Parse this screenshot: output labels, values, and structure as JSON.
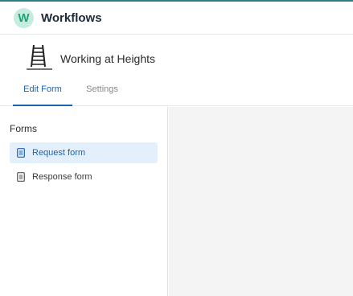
{
  "app": {
    "logo_letter": "W",
    "title": "Workflows"
  },
  "header": {
    "thumbnail_icon": "ladder-icon",
    "workflow_name": "Working at Heights"
  },
  "tabs": [
    {
      "label": "Edit Form",
      "active": true
    },
    {
      "label": "Settings",
      "active": false
    }
  ],
  "sidebar": {
    "heading": "Forms",
    "items": [
      {
        "label": "Request form",
        "icon": "document-icon",
        "selected": true
      },
      {
        "label": "Response form",
        "icon": "document-icon",
        "selected": false
      }
    ]
  },
  "colors": {
    "accent": "#1f63b0",
    "brand": "#1fa37a",
    "selected_bg": "#e3f0fb",
    "canvas_bg": "#f4f4f4"
  }
}
